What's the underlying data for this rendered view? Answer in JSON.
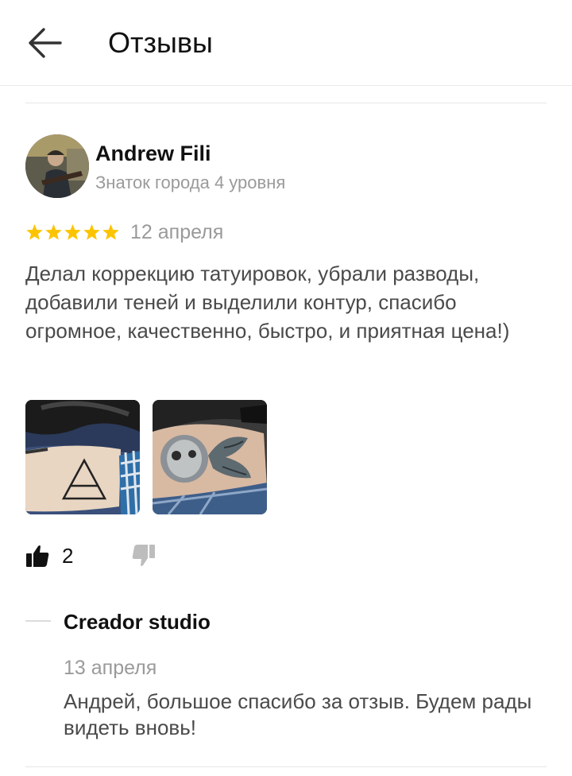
{
  "header": {
    "title": "Отзывы",
    "back_icon": "arrow-left-icon"
  },
  "review": {
    "author": "Andrew Fili",
    "level": "Знаток города 4 уровня",
    "rating": 5,
    "rating_max": 5,
    "star_color": "#fcc400",
    "date": "12 апреля",
    "text": "Делал коррекцию татуировок, убрали разводы, добавили теней и выделили контур, спасибо огромное, качественно, быстро, и приятная цена!)",
    "photos": [
      "photo-triangle-tattoo",
      "photo-rabbit-tattoo"
    ],
    "likes": "2",
    "like_icon": "thumbs-up-icon",
    "dislike_icon": "thumbs-down-icon"
  },
  "reply": {
    "author": "Creador studio",
    "date": "13 апреля",
    "text": "Андрей, большое спасибо за отзыв. Будем рады видеть вновь!"
  }
}
